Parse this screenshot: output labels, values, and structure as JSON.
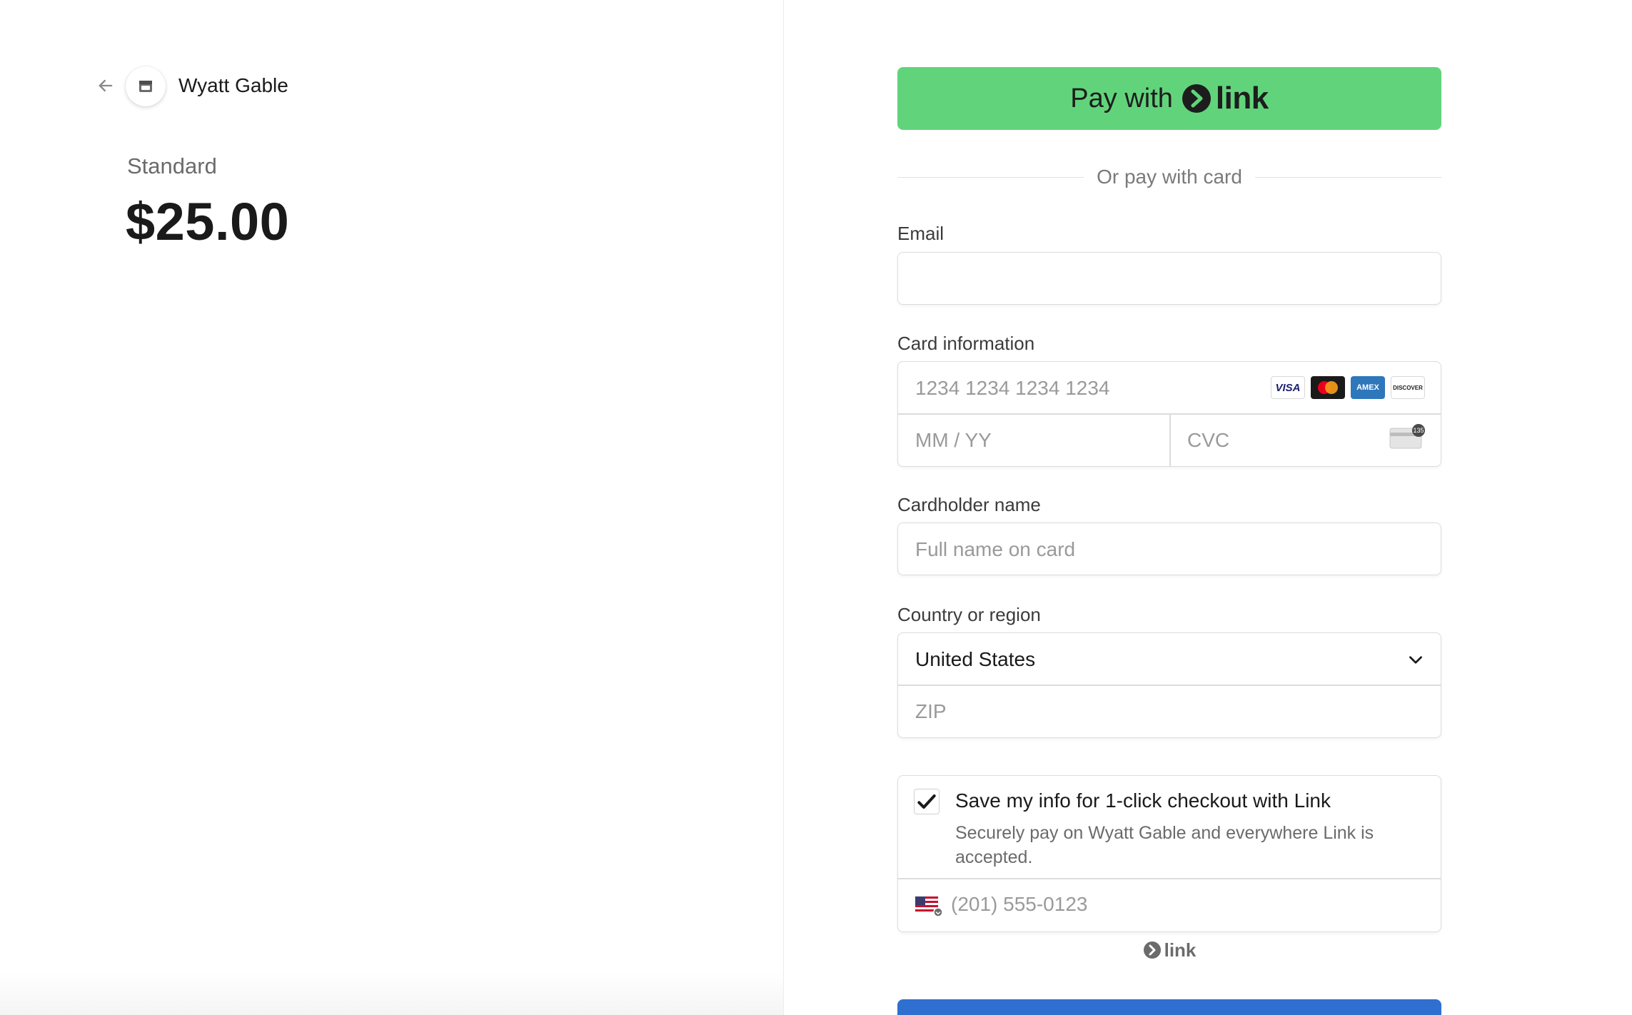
{
  "merchant": {
    "name": "Wyatt Gable"
  },
  "product": {
    "name": "Standard",
    "price": "$25.00"
  },
  "link_button": {
    "prefix": "Pay with",
    "brand": "link"
  },
  "divider_text": "Or pay with card",
  "email": {
    "label": "Email",
    "value": ""
  },
  "card": {
    "label": "Card information",
    "number_placeholder": "1234 1234 1234 1234",
    "expiry_placeholder": "MM / YY",
    "cvc_placeholder": "CVC",
    "brands": [
      "VISA",
      "mastercard",
      "AMEX",
      "DISCOVER"
    ],
    "cvc_icon_text": "135"
  },
  "cardholder": {
    "label": "Cardholder name",
    "placeholder": "Full name on card"
  },
  "country": {
    "label": "Country or region",
    "selected": "United States",
    "zip_placeholder": "ZIP"
  },
  "save_info": {
    "checked": true,
    "title": "Save my info for 1-click checkout with Link",
    "description": "Securely pay on Wyatt Gable and everywhere Link is accepted.",
    "phone_placeholder": "(201) 555-0123"
  },
  "footer_brand": "link",
  "colors": {
    "link_green": "#61d47b",
    "pay_blue": "#2f6fd0",
    "border": "#dcdcdc"
  },
  "icons": {
    "back": "arrow-left-icon",
    "merchant": "store-icon",
    "chevron": "chevron-down-icon",
    "check": "checkmark-icon",
    "flag": "us-flag-icon"
  }
}
